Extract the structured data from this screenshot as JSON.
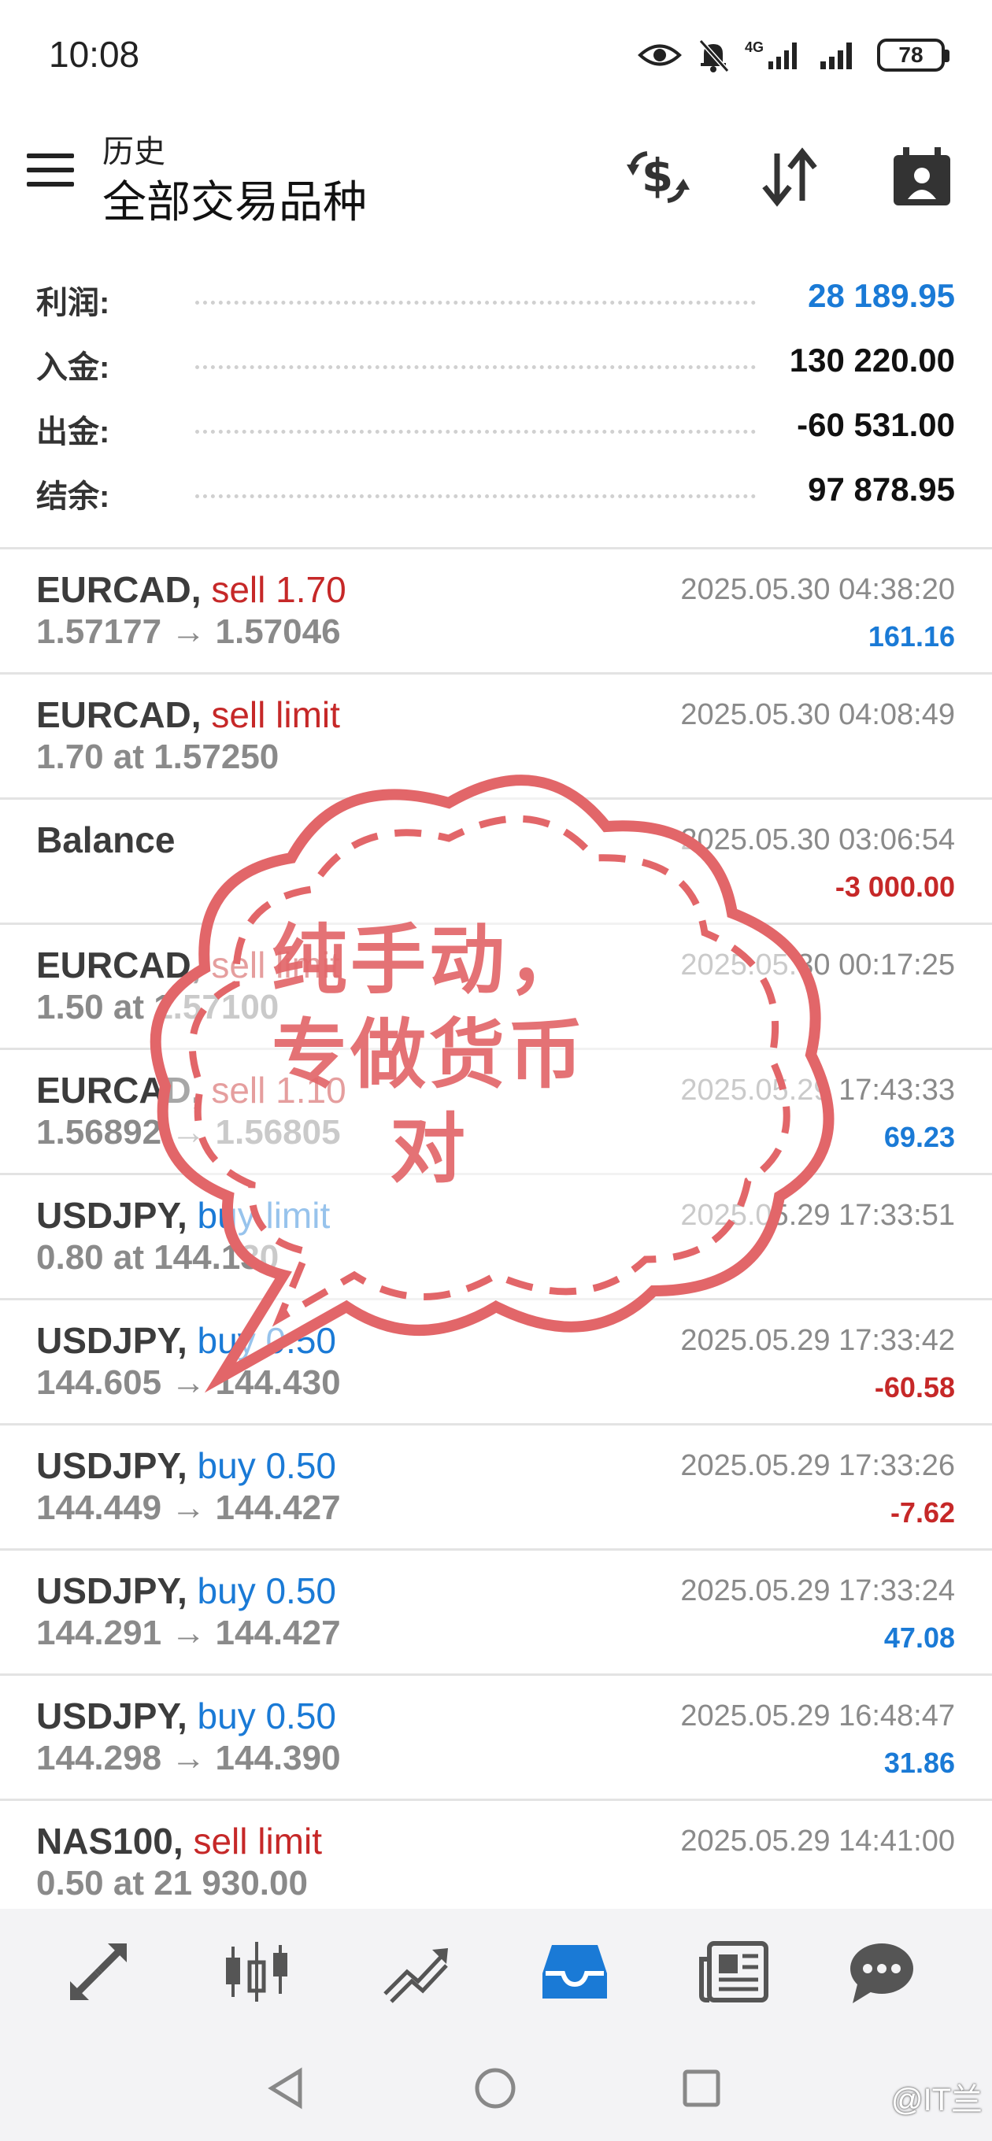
{
  "status_bar": {
    "time": "10:08",
    "network": "4G",
    "battery": "78"
  },
  "header": {
    "subtitle": "历史",
    "title": "全部交易品种"
  },
  "icons": {
    "menu": "hamburger-menu-icon",
    "currency": "currency-exchange-icon",
    "sort": "sort-arrows-icon",
    "calendar": "calendar-person-icon"
  },
  "summary": [
    {
      "label": "利润:",
      "value": "28 189.95",
      "color": "#1a7ad6"
    },
    {
      "label": "入金:",
      "value": "130 220.00",
      "color": "#111111"
    },
    {
      "label": "出金:",
      "value": "-60 531.00",
      "color": "#111111"
    },
    {
      "label": "结余:",
      "value": "97 878.95",
      "color": "#111111"
    }
  ],
  "deals": [
    {
      "symbol": "EURCAD,",
      "action": "sell 1.70",
      "action_color": "red",
      "detail": "1.57177 → 1.57046",
      "date": "2025.05.30 04:38:20",
      "profit": "161.16",
      "profit_color": "blue"
    },
    {
      "symbol": "EURCAD,",
      "action": "sell limit",
      "action_color": "red",
      "detail": "1.70 at 1.57250",
      "date": "2025.05.30 04:08:49",
      "profit": "",
      "profit_color": "blue"
    },
    {
      "symbol": "Balance",
      "action": "",
      "action_color": "red",
      "detail": "",
      "date": "2025.05.30 03:06:54",
      "profit": "-3 000.00",
      "profit_color": "red"
    },
    {
      "symbol": "EURCAD,",
      "action": "sell limit",
      "action_color": "red",
      "detail": "1.50 at 1.57100",
      "date": "2025.05.30 00:17:25",
      "profit": "",
      "profit_color": "blue"
    },
    {
      "symbol": "EURCAD,",
      "action": "sell 1.10",
      "action_color": "red",
      "detail": "1.56892 → 1.56805",
      "date": "2025.05.29 17:43:33",
      "profit": "69.23",
      "profit_color": "blue"
    },
    {
      "symbol": "USDJPY,",
      "action": "buy limit",
      "action_color": "blue",
      "detail": "0.80 at 144.130",
      "date": "2025.05.29 17:33:51",
      "profit": "",
      "profit_color": "blue"
    },
    {
      "symbol": "USDJPY,",
      "action": "buy 0.50",
      "action_color": "blue",
      "detail": "144.605 → 144.430",
      "date": "2025.05.29 17:33:42",
      "profit": "-60.58",
      "profit_color": "red"
    },
    {
      "symbol": "USDJPY,",
      "action": "buy 0.50",
      "action_color": "blue",
      "detail": "144.449 → 144.427",
      "date": "2025.05.29 17:33:26",
      "profit": "-7.62",
      "profit_color": "red"
    },
    {
      "symbol": "USDJPY,",
      "action": "buy 0.50",
      "action_color": "blue",
      "detail": "144.291 → 144.427",
      "date": "2025.05.29 17:33:24",
      "profit": "47.08",
      "profit_color": "blue"
    },
    {
      "symbol": "USDJPY,",
      "action": "buy 0.50",
      "action_color": "blue",
      "detail": "144.298 → 144.390",
      "date": "2025.05.29 16:48:47",
      "profit": "31.86",
      "profit_color": "blue"
    },
    {
      "symbol": "NAS100,",
      "action": "sell limit",
      "action_color": "red",
      "detail": "0.50 at 21 930.00",
      "date": "2025.05.29 14:41:00",
      "profit": "",
      "profit_color": "blue"
    }
  ],
  "stamp": {
    "line1": "纯手动，",
    "line2": "专做货币",
    "line3": "对",
    "color": "#e26669"
  },
  "bottom_nav": [
    {
      "name": "quotes",
      "icon": "quotes-arrows-icon",
      "active": false
    },
    {
      "name": "chart",
      "icon": "candlestick-icon",
      "active": false
    },
    {
      "name": "trade",
      "icon": "trade-chart-icon",
      "active": false
    },
    {
      "name": "history",
      "icon": "inbox-tray-icon",
      "active": true
    },
    {
      "name": "news",
      "icon": "newspaper-icon",
      "active": false
    },
    {
      "name": "chat",
      "icon": "chat-bubble-icon",
      "active": false
    }
  ],
  "watermark": "@IT兰",
  "colors": {
    "blue": "#1a7ad6",
    "red": "#c62828",
    "active": "#1a7ad6",
    "inactive": "#555555"
  }
}
